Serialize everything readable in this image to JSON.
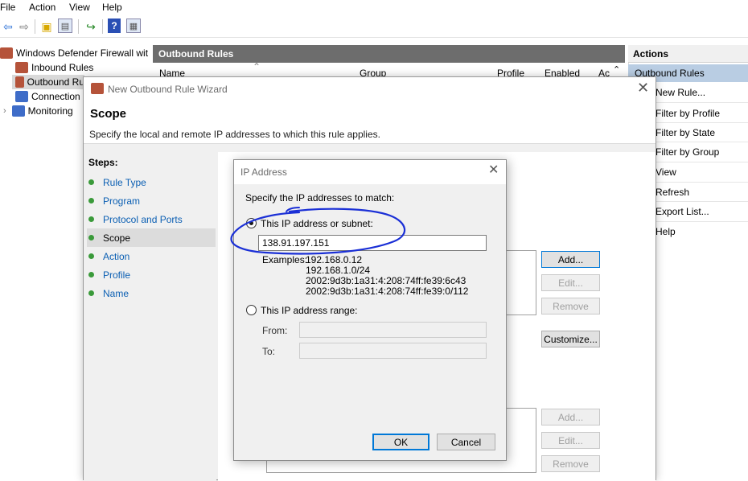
{
  "menu": [
    "File",
    "Action",
    "View",
    "Help"
  ],
  "toolbar": {
    "icons": [
      "back-arrow-icon",
      "forward-arrow-icon",
      "up-folder-icon",
      "show-hide-tree-icon",
      "export-list-icon",
      "help-icon",
      "properties-icon"
    ]
  },
  "tree": {
    "items": [
      {
        "label": "Windows Defender Firewall wit"
      },
      {
        "label": "Inbound Rules"
      },
      {
        "label": "Outbound Ru"
      },
      {
        "label": "Connection"
      },
      {
        "label": "Monitoring"
      }
    ]
  },
  "center": {
    "title": "Outbound Rules",
    "columns": [
      "Name",
      "Group",
      "Profile",
      "Enabled",
      "Ac"
    ]
  },
  "actions": {
    "title": "Actions",
    "section": "Outbound Rules",
    "items": [
      "New Rule...",
      "Filter by Profile",
      "Filter by State",
      "Filter by Group",
      "View",
      "Refresh",
      "Export List...",
      "Help"
    ]
  },
  "wizard": {
    "title": "New Outbound Rule Wizard",
    "heading": "Scope",
    "subheading": "Specify the local and remote IP addresses to which this rule applies.",
    "steps_label": "Steps:",
    "steps": [
      {
        "label": "Rule Type",
        "current": false
      },
      {
        "label": "Program",
        "current": false
      },
      {
        "label": "Protocol and Ports",
        "current": false
      },
      {
        "label": "Scope",
        "current": true
      },
      {
        "label": "Action",
        "current": false
      },
      {
        "label": "Profile",
        "current": false
      },
      {
        "label": "Name",
        "current": false
      }
    ],
    "buttons": {
      "add": "Add...",
      "edit": "Edit...",
      "remove": "Remove",
      "customize": "Customize...",
      "add2": "Add...",
      "edit2": "Edit...",
      "remove2": "Remove"
    }
  },
  "ip_dialog": {
    "title": "IP Address",
    "prompt": "Specify the IP addresses to match:",
    "option_subnet": "This IP address or subnet:",
    "subnet_value": "138.91.197.151",
    "examples_label": "Examples:",
    "examples": [
      "192.168.0.12",
      "192.168.1.0/24",
      "2002:9d3b:1a31:4:208:74ff:fe39:6c43",
      "2002:9d3b:1a31:4:208:74ff:fe39:0/112"
    ],
    "option_range": "This IP address range:",
    "from_label": "From:",
    "to_label": "To:",
    "ok": "OK",
    "cancel": "Cancel"
  },
  "annotation_color": "#1a2fd6"
}
